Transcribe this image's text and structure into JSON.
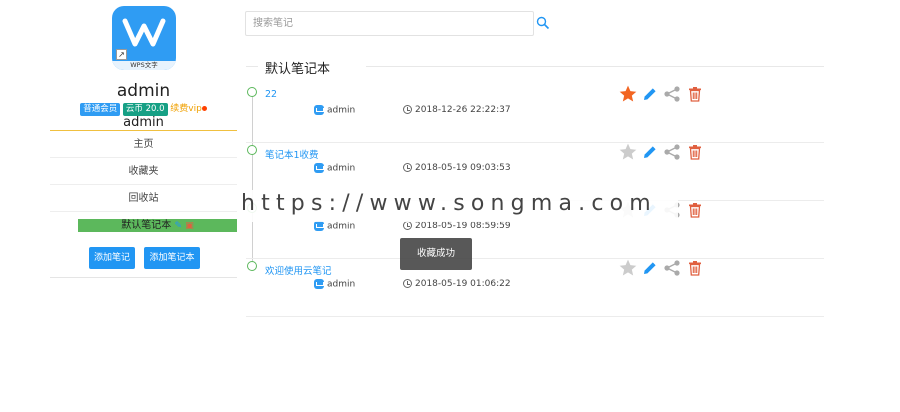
{
  "sidebar": {
    "app_caption": "WPS文字",
    "shortcut_glyph": "↗",
    "username": "admin",
    "badges": {
      "member": "普通会员",
      "cloud": "云币 20.0",
      "renew": "续费vip"
    },
    "username2": "admin",
    "nav": [
      "主页",
      "收藏夹",
      "回收站"
    ],
    "selected_notebook": "默认笔记本",
    "buttons": {
      "add_note": "添加笔记",
      "add_notebook": "添加笔记本"
    }
  },
  "search": {
    "placeholder": "搜索笔记",
    "value": ""
  },
  "notebook_title": "默认笔记本",
  "notes": [
    {
      "title": "22",
      "author": "admin",
      "time": "2018-12-26 22:22:37",
      "starred": true
    },
    {
      "title": "笔记本1收费",
      "author": "admin",
      "time": "2018-05-19 09:03:53",
      "starred": false
    },
    {
      "title": "",
      "author": "admin",
      "time": "2018-05-19 08:59:59",
      "starred": false
    },
    {
      "title": "欢迎使用云笔记",
      "author": "admin",
      "time": "2018-05-19 01:06:22",
      "starred": false
    }
  ],
  "watermark": "https://www.songma.com",
  "toast": "收藏成功",
  "colors": {
    "accent": "#2196f3",
    "star_active": "#f26522",
    "star_inactive": "#cccccc",
    "delete": "#e06040",
    "share": "#aaaaaa",
    "green": "#5cb85c"
  }
}
